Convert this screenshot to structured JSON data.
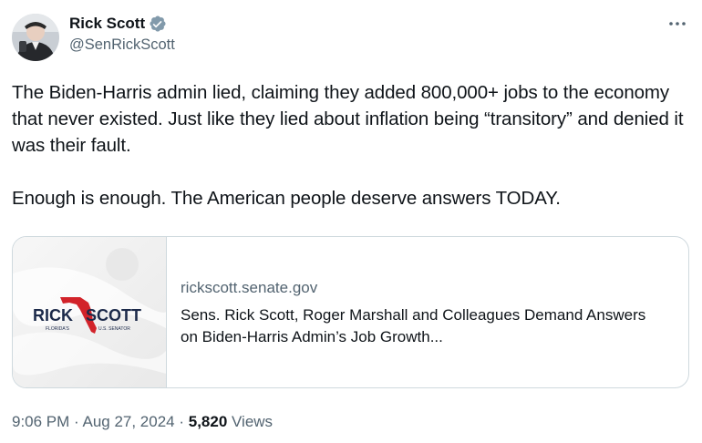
{
  "author": {
    "display_name": "Rick Scott",
    "handle": "@SenRickScott",
    "verified_icon": "verified-badge-gray"
  },
  "tweet": {
    "text": "The Biden-Harris admin lied, claiming they added 800,000+ jobs to the economy that never existed. Just like they lied about inflation being “transitory” and denied it was their fault.\n\nEnough is enough. The American people deserve answers TODAY."
  },
  "link_card": {
    "domain": "rickscott.senate.gov",
    "title": "Sens. Rick Scott, Roger Marshall and Colleagues Demand Answers on Biden-Harris Admin’s Job Growth...",
    "logo": {
      "word_left": "RICK",
      "word_right": "SCOTT",
      "sub_left": "FLORIDA'S",
      "sub_right": "U.S. SENATOR"
    }
  },
  "meta": {
    "time": "9:06 PM",
    "sep1": " · ",
    "date": "Aug 27, 2024",
    "sep2": " · ",
    "views_count": "5,820",
    "views_label": " Views"
  },
  "colors": {
    "text_primary": "#0f1419",
    "text_secondary": "#536471",
    "border": "#cfd9de",
    "logo_red": "#d2232a",
    "logo_navy": "#1c2a4a",
    "verified_gray": "#829aab"
  }
}
